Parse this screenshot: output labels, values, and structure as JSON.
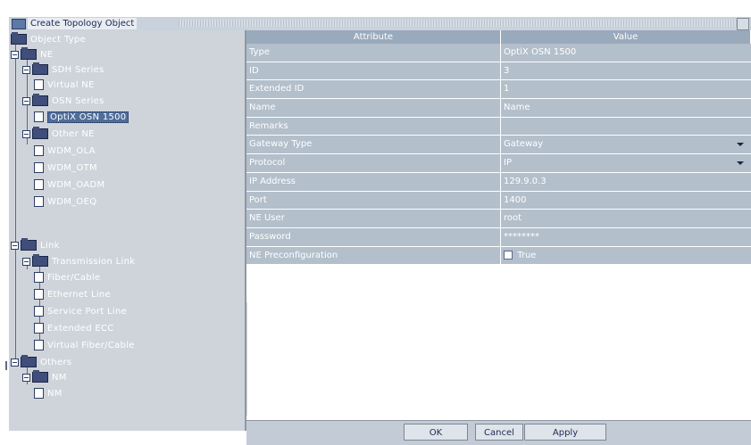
{
  "window": {
    "title": "Create Topology Object"
  },
  "tree": {
    "root_label": "Object Type",
    "items": [
      {
        "label": "NE"
      },
      {
        "label": "SDH Series"
      },
      {
        "label": "Virtual NE"
      },
      {
        "label": "OSN Series"
      },
      {
        "label": "OptiX OSN 1500"
      },
      {
        "label": "Other NE"
      },
      {
        "label": "WDM_OLA"
      },
      {
        "label": "WDM_OTM"
      },
      {
        "label": "WDM_OADM"
      },
      {
        "label": "WDM_OEQ"
      },
      {
        "label": "Link"
      },
      {
        "label": "Transmission Link"
      },
      {
        "label": "Fiber/Cable"
      },
      {
        "label": "Ethernet Line"
      },
      {
        "label": "Service Port Line"
      },
      {
        "label": "Extended ECC"
      },
      {
        "label": "Virtual Fiber/Cable"
      },
      {
        "label": "Others"
      },
      {
        "label": "NM"
      },
      {
        "label": "NM"
      }
    ]
  },
  "grid": {
    "col_attribute": "Attribute",
    "col_value": "Value",
    "rows": [
      {
        "attr": "Type",
        "value": "OptiX OSN 1500"
      },
      {
        "attr": "ID",
        "value": "3"
      },
      {
        "attr": "Extended ID",
        "value": "1"
      },
      {
        "attr": "Name",
        "value": "Name"
      },
      {
        "attr": "Remarks",
        "value": ""
      },
      {
        "attr": "Gateway Type",
        "value": "Gateway"
      },
      {
        "attr": "Protocol",
        "value": "IP"
      },
      {
        "attr": "IP Address",
        "value": "129.9.0.3"
      },
      {
        "attr": "Port",
        "value": "1400"
      },
      {
        "attr": "NE User",
        "value": "root"
      },
      {
        "attr": "Password",
        "value": "********"
      },
      {
        "attr": "NE Preconfiguration",
        "value": "True"
      }
    ]
  },
  "buttons": {
    "ok": "OK",
    "cancel": "Cancel",
    "apply": "Apply"
  }
}
